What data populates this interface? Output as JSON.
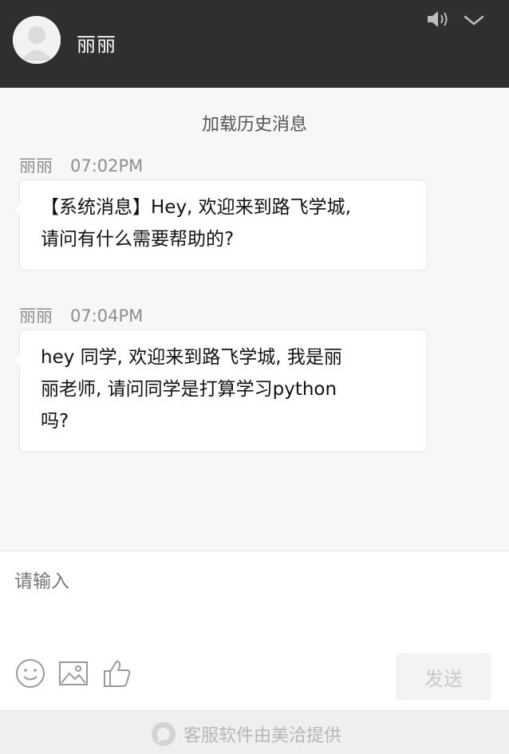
{
  "header": {
    "agent_name": "丽丽",
    "avatar_icon": "user-avatar-icon",
    "sound_icon": "speaker-icon",
    "collapse_icon": "chevron-down-icon"
  },
  "chat": {
    "load_history": "加载历史消息",
    "messages": [
      {
        "sender": "丽丽",
        "time": "07:02PM",
        "lines": [
          "【系统消息】Hey, 欢迎来到路飞学城,",
          "请问有什么需要帮助的?"
        ]
      },
      {
        "sender": "丽丽",
        "time": "07:04PM",
        "lines": [
          "hey 同学, 欢迎来到路飞学城, 我是丽",
          "丽老师, 请问同学是打算学习python",
          "吗?"
        ]
      }
    ]
  },
  "input": {
    "placeholder": "请输入",
    "tools": [
      "smiley-icon",
      "image-icon",
      "thumbs-up-icon"
    ],
    "send_label": "发送"
  },
  "footer": {
    "text": "客服软件由美洽提供",
    "icon": "meiqia-logo-icon"
  },
  "colors": {
    "header_bg": "#2f2f2f",
    "send_disabled_bg": "#f3f3f3"
  }
}
